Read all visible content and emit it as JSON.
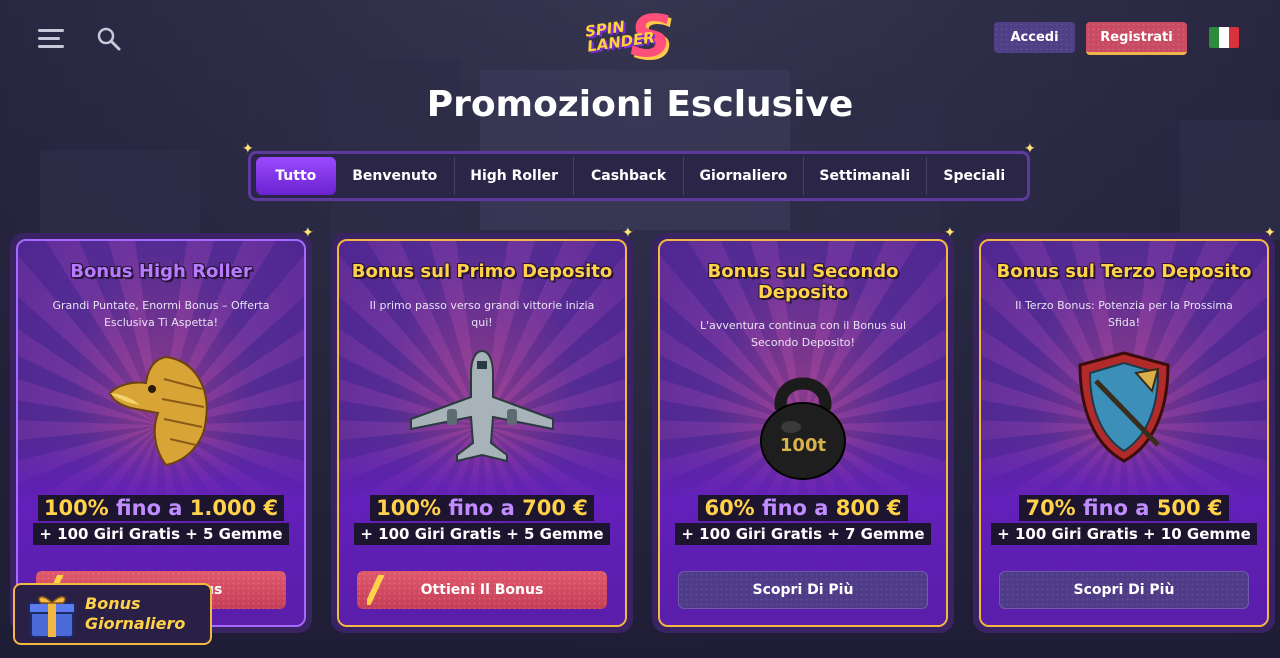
{
  "header": {
    "login_label": "Accedi",
    "register_label": "Registrati",
    "logo_text_line1": "SPIN",
    "logo_text_line2": "LANDER",
    "logo_mark": "S",
    "flag_colors": [
      "#2d8c3c",
      "#ffffff",
      "#d9323c"
    ]
  },
  "page_title": "Promozioni Esclusive",
  "tabs": [
    {
      "label": "Tutto",
      "active": true
    },
    {
      "label": "Benvenuto"
    },
    {
      "label": "High Roller"
    },
    {
      "label": "Cashback"
    },
    {
      "label": "Giornaliero"
    },
    {
      "label": "Settimanali"
    },
    {
      "label": "Speciali"
    }
  ],
  "cards": [
    {
      "title": "Bonus High Roller",
      "description": "Grandi Puntate, Enormi Bonus – Offerta Esclusiva Ti Aspetta!",
      "art": "eagle-icon",
      "offer_amount": "100%",
      "offer_fino": "fino a",
      "offer_value": "1.000 €",
      "offer_extra": "+ 100 Giri Gratis + 5 Gemme",
      "cta_label": "Ottieni Il Bonus"
    },
    {
      "title": "Bonus sul Primo Deposito",
      "description": "Il primo passo verso grandi vittorie inizia qui!",
      "art": "airplane-icon",
      "offer_amount": "100%",
      "offer_fino": "fino a",
      "offer_value": "700 €",
      "offer_extra": "+ 100 Giri Gratis + 5 Gemme",
      "cta_label": "Ottieni Il Bonus"
    },
    {
      "title": "Bonus sul Secondo Deposito",
      "description": "L'avventura continua con il Bonus sul Secondo Deposito!",
      "art": "kettlebell-icon",
      "art_text": "100t",
      "offer_amount": "60%",
      "offer_fino": "fino a",
      "offer_value": "800 €",
      "offer_extra": "+ 100 Giri Gratis + 7 Gemme",
      "cta_label": "Scopri Di Più"
    },
    {
      "title": "Bonus sul Terzo Deposito",
      "description": "Il Terzo Bonus: Potenzia per la Prossima Sfida!",
      "art": "shield-icon",
      "offer_amount": "70%",
      "offer_fino": "fino a",
      "offer_value": "500 €",
      "offer_extra": "+ 100 Giri Gratis + 10 Gemme",
      "cta_label": "Scopri Di Più"
    }
  ],
  "daily_bonus": {
    "line1": "Bonus",
    "line2": "Giornaliero",
    "icon": "gift-box-icon"
  },
  "colors": {
    "accent_gold": "#ffd24a",
    "accent_purple": "#9a4bff",
    "cta_red": "#c43e57"
  }
}
